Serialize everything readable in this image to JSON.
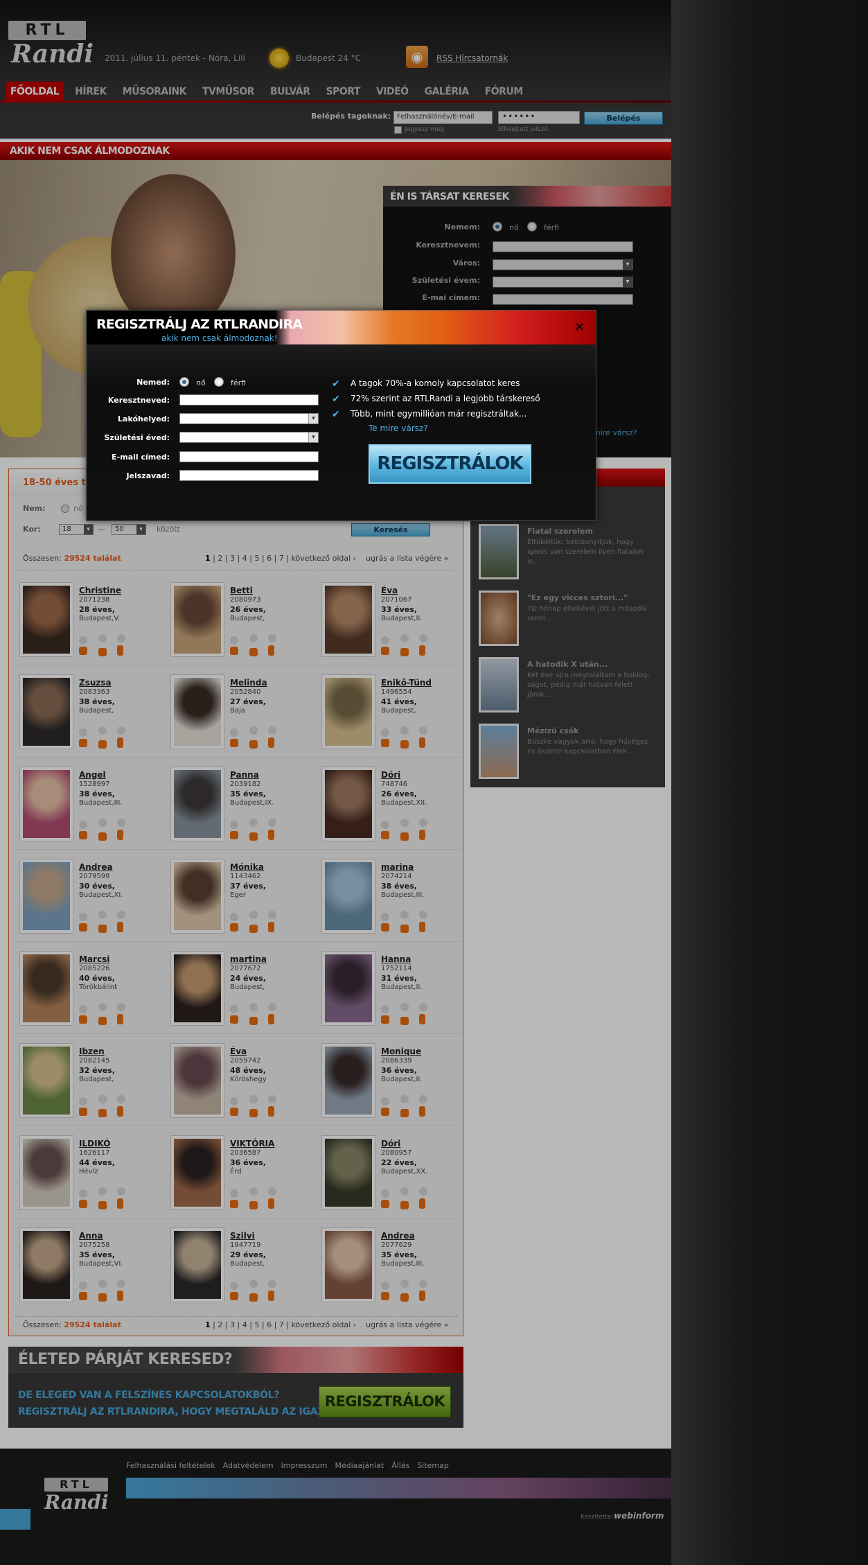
{
  "header": {
    "logo_top": "RTL",
    "logo_bottom": "Randi",
    "date_line": "2011. július 11. péntek - Nóra, Lili",
    "weather": "Budapest 24 °C",
    "rss_label": "RSS Hírcsatornák"
  },
  "nav": {
    "items": [
      "FŐOLDAL",
      "HÍREK",
      "MŰSORAINK",
      "TVMŰSOR",
      "BULVÁR",
      "SPORT",
      "VIDEÓ",
      "GALÉRIA",
      "FÓRUM"
    ]
  },
  "login": {
    "label": "Belépés tagoknak:",
    "username_value": "Felhasználónév/E-mail",
    "password_value": "••••••",
    "button": "Belépés",
    "remember": "Jegyezz meg",
    "forgot": "Elfelejtett jelszó"
  },
  "banner": {
    "title": "AKIK NEM CSAK ÁLMODOZNAK"
  },
  "search_panel": {
    "title": "ÉN IS TÁRSAT KERESEK",
    "gender_label": "Nemem:",
    "female": "nő",
    "male": "férfi",
    "firstname_label": "Keresztnevem:",
    "city_label": "Város:",
    "birthyear_label": "Születési évem:",
    "email_label": "E-mai címem:",
    "partial_link": "mire vársz?"
  },
  "results": {
    "title_partial": "18-50 éves ta",
    "nem_label": "Nem:",
    "nem_value": "nő",
    "kor_label": "Kor:",
    "age_from": "18",
    "age_dash": "—",
    "age_to": "50",
    "between": "között",
    "search_button": "Keresés",
    "total_label": "Összesen:",
    "total_value": "29524 találat",
    "pages": [
      "1",
      "2",
      "3",
      "4",
      "5",
      "6",
      "7"
    ],
    "next": "következő oldal ›",
    "last": "ugrás a lista végére »"
  },
  "profiles": [
    {
      "name": "Christine",
      "id": "2071238",
      "age": "28 éves,",
      "location": "Budapest,V."
    },
    {
      "name": "Betti",
      "id": "2080973",
      "age": "26 éves,",
      "location": "Budapest,"
    },
    {
      "name": "Éva",
      "id": "2071067",
      "age": "33 éves,",
      "location": "Budapest,II."
    },
    {
      "name": "Zsuzsa",
      "id": "2083363",
      "age": "38 éves,",
      "location": "Budapest,"
    },
    {
      "name": "Melinda",
      "id": "2052840",
      "age": "27 éves,",
      "location": "Baja"
    },
    {
      "name": "Enikő-Tünd",
      "id": "1496554",
      "age": "41 éves,",
      "location": "Budapest,"
    },
    {
      "name": "Angel",
      "id": "1528997",
      "age": "38 éves,",
      "location": "Budapest,III."
    },
    {
      "name": "Panna",
      "id": "2039182",
      "age": "35 éves,",
      "location": "Budapest,IX."
    },
    {
      "name": "Dóri",
      "id": "748746",
      "age": "26 éves,",
      "location": "Budapest,XII."
    },
    {
      "name": "Andrea",
      "id": "2079599",
      "age": "30 éves,",
      "location": "Budapest,XI."
    },
    {
      "name": "Mónika",
      "id": "1143462",
      "age": "37 éves,",
      "location": "Eger"
    },
    {
      "name": "marina",
      "id": "2074214",
      "age": "38 éves,",
      "location": "Budapest,III."
    },
    {
      "name": "Marcsi",
      "id": "2085226",
      "age": "40 éves,",
      "location": "Törökbálint"
    },
    {
      "name": "martina",
      "id": "2077672",
      "age": "24 éves,",
      "location": "Budapest,"
    },
    {
      "name": "Hanna",
      "id": "1752114",
      "age": "31 éves,",
      "location": "Budapest,II."
    },
    {
      "name": "Ibzen",
      "id": "2082145",
      "age": "32 éves,",
      "location": "Budapest,"
    },
    {
      "name": "Éva",
      "id": "2059742",
      "age": "48 éves,",
      "location": "Kőröshegy"
    },
    {
      "name": "Monique",
      "id": "2086339",
      "age": "36 éves,",
      "location": "Budapest,II."
    },
    {
      "name": "ILDIKÓ",
      "id": "1626117",
      "age": "44 éves,",
      "location": "Hévíz"
    },
    {
      "name": "VIKTÓRIA",
      "id": "2036587",
      "age": "36 éves,",
      "location": "Érd"
    },
    {
      "name": "Dóri",
      "id": "2080957",
      "age": "22 éves,",
      "location": "Budapest,XX."
    },
    {
      "name": "Anna",
      "id": "2075258",
      "age": "35 éves,",
      "location": "Budapest,VI."
    },
    {
      "name": "Szilvi",
      "id": "1947719",
      "age": "29 éves,",
      "location": "Budapest,"
    },
    {
      "name": "Andrea",
      "id": "2077629",
      "age": "35 éves,",
      "location": "Budapest,III."
    }
  ],
  "stories": [
    {
      "title": "Fiatal szerelem",
      "text": "Eltökéltük: bebizonyítjuk, hogy igenis van szerelem ilyen fiatalon is..."
    },
    {
      "title": "\"Ez egy vicces sztori...\"",
      "text": "Tíz hónap elteltével jött a második randi..."
    },
    {
      "title": "A hatodik X után...",
      "text": "Két éve újra megtaláltam a boldog-ságot, pedig már hatvan felett járok..."
    },
    {
      "title": "Mézízű csók",
      "text": "Büszke vagyok arra, hogy hűséges és őszinte kapcsolatban élek..."
    }
  ],
  "promo": {
    "title": "ÉLETED PÁRJÁT KERESED?",
    "line1": "DE ELEGED VAN A FELSZÍNES KAPCSOLATOKBÓL?",
    "line2": "REGISZTRÁLJ AZ RTLRANDIRA, HOGY MEGTALÁLD AZ IGAZIT!",
    "button": "REGISZTRÁLOK"
  },
  "footer": {
    "links": [
      "Felhasználási feltételek",
      "Adatvédelem",
      "Impresszum",
      "Médiaajánlat",
      "Állás",
      "Sitemap"
    ],
    "credit": "Készítette:",
    "credit_logo": "webinform"
  },
  "modal": {
    "title": "REGISZTRÁLJ AZ RTLRANDIRA",
    "subtitle": "akik nem csak álmodoznak!",
    "close": "✕",
    "gender_label": "Nemed:",
    "female": "nő",
    "male": "férfi",
    "firstname_label": "Keresztneved:",
    "residence_label": "Lakóhelyed:",
    "birthyear_label": "Születési éved:",
    "email_label": "E-mail címed:",
    "password_label": "Jelszavad:",
    "bullets": [
      "A tagok 70%-a komoly kapcsolatot keres",
      "72% szerint az RTLRandi a legjobb társkereső",
      "Több, mint egymillióan már regisztráltak..."
    ],
    "link": "Te mire vársz?",
    "button": "REGISZTRÁLOK"
  },
  "colors": {
    "brand_red": "#c40000",
    "accent_blue": "#4fb0e5",
    "accent_orange": "#e15a1c",
    "promo_green": "#7aae2a"
  }
}
